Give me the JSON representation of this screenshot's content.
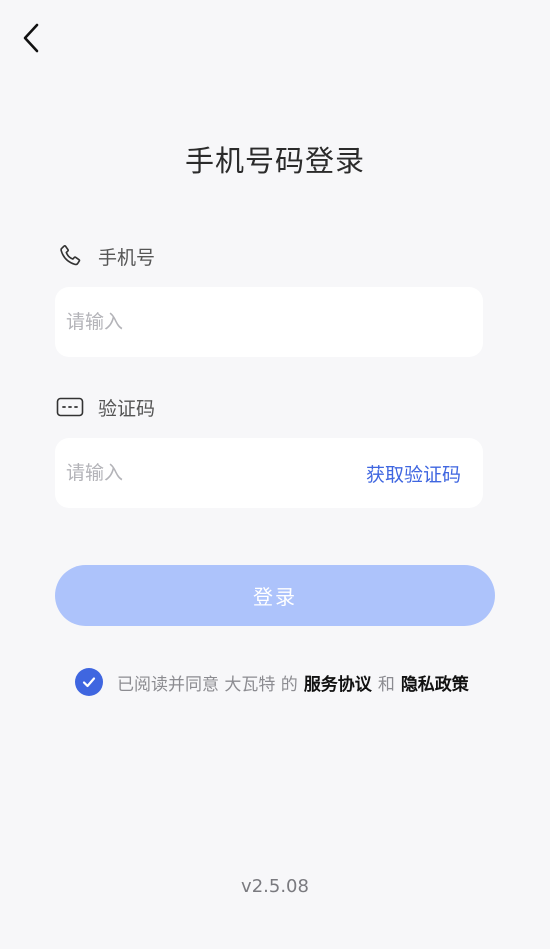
{
  "header": {
    "back_icon": "chevron-left-icon",
    "title": "手机号码登录"
  },
  "phone": {
    "icon": "phone-icon",
    "label": "手机号",
    "placeholder": "请输入",
    "value": ""
  },
  "code": {
    "icon": "keyboard-icon",
    "label": "验证码",
    "placeholder": "请输入",
    "value": "",
    "get_code_label": "获取验证码"
  },
  "login_button": {
    "label": "登录"
  },
  "agreement": {
    "checked": true,
    "checkbox_icon": "check-circle-icon",
    "prefix": "已阅读并同意 大瓦特 的",
    "service_link": "服务协议",
    "conjunction": "和",
    "privacy_link": "隐私政策"
  },
  "version": "v2.5.08",
  "colors": {
    "accent": "#3f66e0",
    "login_button_bg": "#adc3fb",
    "background": "#f7f7f9"
  }
}
